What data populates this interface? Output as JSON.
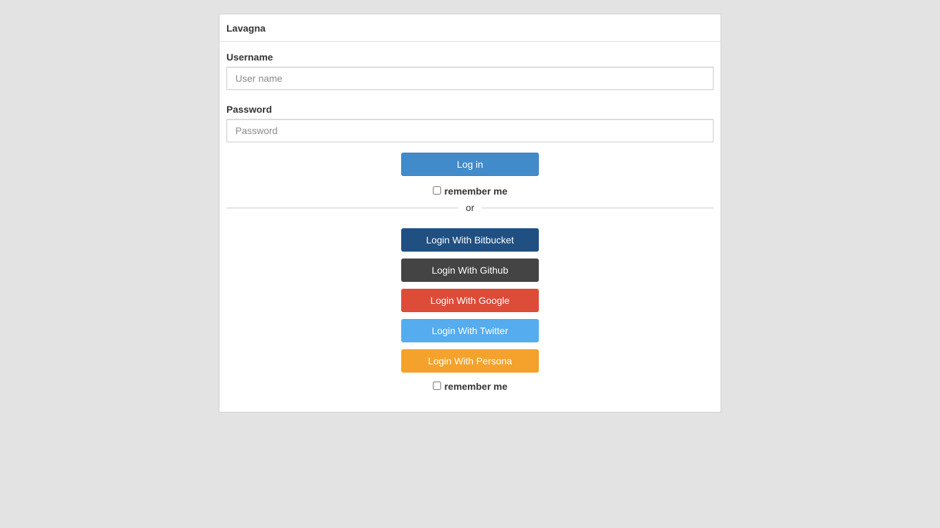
{
  "panel": {
    "title": "Lavagna"
  },
  "form": {
    "username_label": "Username",
    "username_placeholder": "User name",
    "username_value": "",
    "password_label": "Password",
    "password_placeholder": "Password",
    "password_value": "",
    "login_label": "Log in",
    "remember_label": "remember me",
    "divider_text": "or"
  },
  "social": {
    "bitbucket_label": "Login With Bitbucket",
    "github_label": "Login With Github",
    "google_label": "Login With Google",
    "twitter_label": "Login With Twitter",
    "persona_label": "Login With Persona",
    "remember_label": "remember me"
  },
  "colors": {
    "page_background": "#e3e3e3",
    "login": "#428bca",
    "bitbucket": "#205081",
    "github": "#444444",
    "google": "#dd4b39",
    "twitter": "#55acee",
    "persona": "#f4a22b"
  }
}
